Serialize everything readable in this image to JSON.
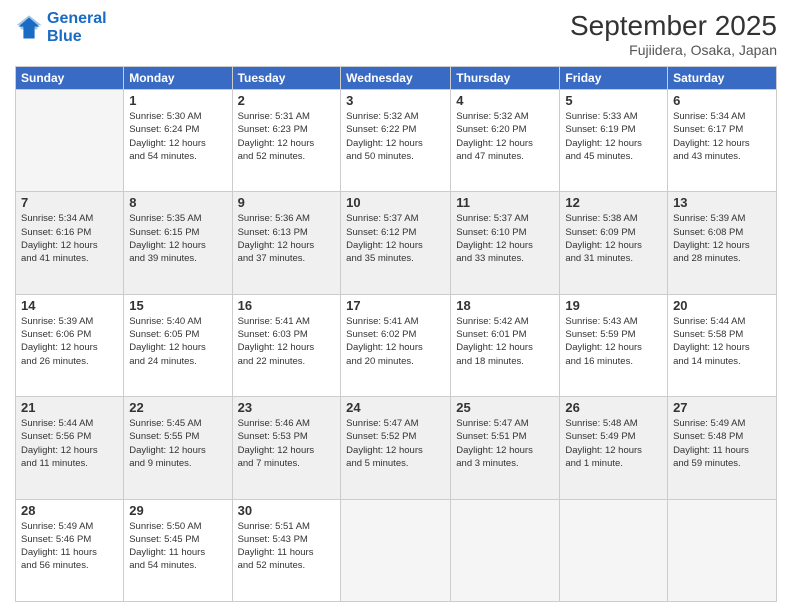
{
  "logo": {
    "line1": "General",
    "line2": "Blue"
  },
  "header": {
    "month": "September 2025",
    "location": "Fujiidera, Osaka, Japan"
  },
  "weekdays": [
    "Sunday",
    "Monday",
    "Tuesday",
    "Wednesday",
    "Thursday",
    "Friday",
    "Saturday"
  ],
  "weeks": [
    [
      {
        "day": "",
        "info": ""
      },
      {
        "day": "1",
        "info": "Sunrise: 5:30 AM\nSunset: 6:24 PM\nDaylight: 12 hours\nand 54 minutes."
      },
      {
        "day": "2",
        "info": "Sunrise: 5:31 AM\nSunset: 6:23 PM\nDaylight: 12 hours\nand 52 minutes."
      },
      {
        "day": "3",
        "info": "Sunrise: 5:32 AM\nSunset: 6:22 PM\nDaylight: 12 hours\nand 50 minutes."
      },
      {
        "day": "4",
        "info": "Sunrise: 5:32 AM\nSunset: 6:20 PM\nDaylight: 12 hours\nand 47 minutes."
      },
      {
        "day": "5",
        "info": "Sunrise: 5:33 AM\nSunset: 6:19 PM\nDaylight: 12 hours\nand 45 minutes."
      },
      {
        "day": "6",
        "info": "Sunrise: 5:34 AM\nSunset: 6:17 PM\nDaylight: 12 hours\nand 43 minutes."
      }
    ],
    [
      {
        "day": "7",
        "info": "Sunrise: 5:34 AM\nSunset: 6:16 PM\nDaylight: 12 hours\nand 41 minutes."
      },
      {
        "day": "8",
        "info": "Sunrise: 5:35 AM\nSunset: 6:15 PM\nDaylight: 12 hours\nand 39 minutes."
      },
      {
        "day": "9",
        "info": "Sunrise: 5:36 AM\nSunset: 6:13 PM\nDaylight: 12 hours\nand 37 minutes."
      },
      {
        "day": "10",
        "info": "Sunrise: 5:37 AM\nSunset: 6:12 PM\nDaylight: 12 hours\nand 35 minutes."
      },
      {
        "day": "11",
        "info": "Sunrise: 5:37 AM\nSunset: 6:10 PM\nDaylight: 12 hours\nand 33 minutes."
      },
      {
        "day": "12",
        "info": "Sunrise: 5:38 AM\nSunset: 6:09 PM\nDaylight: 12 hours\nand 31 minutes."
      },
      {
        "day": "13",
        "info": "Sunrise: 5:39 AM\nSunset: 6:08 PM\nDaylight: 12 hours\nand 28 minutes."
      }
    ],
    [
      {
        "day": "14",
        "info": "Sunrise: 5:39 AM\nSunset: 6:06 PM\nDaylight: 12 hours\nand 26 minutes."
      },
      {
        "day": "15",
        "info": "Sunrise: 5:40 AM\nSunset: 6:05 PM\nDaylight: 12 hours\nand 24 minutes."
      },
      {
        "day": "16",
        "info": "Sunrise: 5:41 AM\nSunset: 6:03 PM\nDaylight: 12 hours\nand 22 minutes."
      },
      {
        "day": "17",
        "info": "Sunrise: 5:41 AM\nSunset: 6:02 PM\nDaylight: 12 hours\nand 20 minutes."
      },
      {
        "day": "18",
        "info": "Sunrise: 5:42 AM\nSunset: 6:01 PM\nDaylight: 12 hours\nand 18 minutes."
      },
      {
        "day": "19",
        "info": "Sunrise: 5:43 AM\nSunset: 5:59 PM\nDaylight: 12 hours\nand 16 minutes."
      },
      {
        "day": "20",
        "info": "Sunrise: 5:44 AM\nSunset: 5:58 PM\nDaylight: 12 hours\nand 14 minutes."
      }
    ],
    [
      {
        "day": "21",
        "info": "Sunrise: 5:44 AM\nSunset: 5:56 PM\nDaylight: 12 hours\nand 11 minutes."
      },
      {
        "day": "22",
        "info": "Sunrise: 5:45 AM\nSunset: 5:55 PM\nDaylight: 12 hours\nand 9 minutes."
      },
      {
        "day": "23",
        "info": "Sunrise: 5:46 AM\nSunset: 5:53 PM\nDaylight: 12 hours\nand 7 minutes."
      },
      {
        "day": "24",
        "info": "Sunrise: 5:47 AM\nSunset: 5:52 PM\nDaylight: 12 hours\nand 5 minutes."
      },
      {
        "day": "25",
        "info": "Sunrise: 5:47 AM\nSunset: 5:51 PM\nDaylight: 12 hours\nand 3 minutes."
      },
      {
        "day": "26",
        "info": "Sunrise: 5:48 AM\nSunset: 5:49 PM\nDaylight: 12 hours\nand 1 minute."
      },
      {
        "day": "27",
        "info": "Sunrise: 5:49 AM\nSunset: 5:48 PM\nDaylight: 11 hours\nand 59 minutes."
      }
    ],
    [
      {
        "day": "28",
        "info": "Sunrise: 5:49 AM\nSunset: 5:46 PM\nDaylight: 11 hours\nand 56 minutes."
      },
      {
        "day": "29",
        "info": "Sunrise: 5:50 AM\nSunset: 5:45 PM\nDaylight: 11 hours\nand 54 minutes."
      },
      {
        "day": "30",
        "info": "Sunrise: 5:51 AM\nSunset: 5:43 PM\nDaylight: 11 hours\nand 52 minutes."
      },
      {
        "day": "",
        "info": ""
      },
      {
        "day": "",
        "info": ""
      },
      {
        "day": "",
        "info": ""
      },
      {
        "day": "",
        "info": ""
      }
    ]
  ]
}
